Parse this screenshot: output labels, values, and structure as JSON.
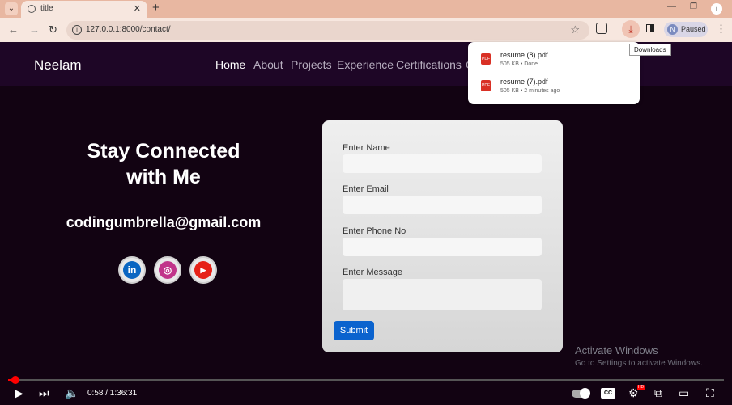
{
  "browser": {
    "tab_title": "title",
    "url": "127.0.0.1:8000/contact/",
    "profile_label": "Paused",
    "profile_initial": "N",
    "tooltip": "Downloads"
  },
  "downloads": [
    {
      "name": "resume (8).pdf",
      "meta": "505 KB • Done"
    },
    {
      "name": "resume (7).pdf",
      "meta": "505 KB • 2 minutes ago"
    }
  ],
  "site": {
    "brand": "Neelam",
    "nav": [
      "Home",
      "About",
      "Projects",
      "Experience",
      "Certifications",
      "C"
    ],
    "heading_line1": "Stay Connected",
    "heading_line2": "with Me",
    "email": "codingumbrella@gmail.com",
    "social": [
      "linkedin-icon",
      "instagram-icon",
      "youtube-icon"
    ]
  },
  "form": {
    "name_label": "Enter Name",
    "email_label": "Enter Email",
    "phone_label": "Enter Phone No",
    "message_label": "Enter Message",
    "submit_label": "Submit"
  },
  "watermark": {
    "line1": "Activate Windows",
    "line2": "Go to Settings to activate Windows."
  },
  "video": {
    "time": "0:58 / 1:36:31",
    "progress_fraction": 0.01
  },
  "colors": {
    "submit": "#0b63ce",
    "page_bg": "#120312",
    "progress": "#ff0000"
  }
}
